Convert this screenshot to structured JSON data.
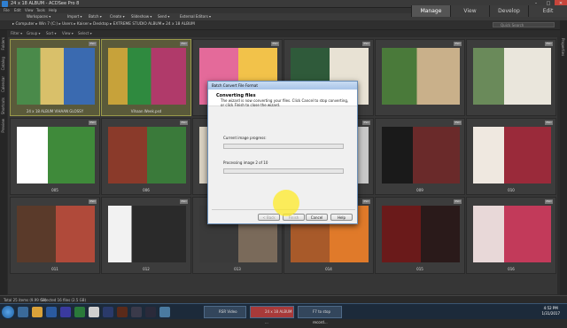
{
  "window": {
    "title": "24 x 18 ALBUM - ACDSee Pro 8"
  },
  "menu": [
    "File",
    "Edit",
    "View",
    "Tools",
    "Help"
  ],
  "toolbar": {
    "items": [
      "Workspaces ▾",
      "Import ▾",
      "Batch ▾",
      "Create ▾",
      "Slideshow ▾",
      "Send ▾",
      "External Editors ▾"
    ],
    "modes": [
      "Manage",
      "View",
      "Develop",
      "Edit"
    ],
    "active_mode": "Manage"
  },
  "path": "▸ Computer ▸ Win 7 (C:) ▸ Users ▸ Kaiser ▸ Desktop ▸ EXTREME STUDIO ALBUM ▸ 24 x 18 ALBUM",
  "quick_search": "Quick Search",
  "filters": [
    "Filter ▾",
    "Group ▾",
    "Sort ▾",
    "View ▾",
    "Select ▾"
  ],
  "left_tabs": [
    "Folders",
    "Catalog",
    "Calendar",
    "Shortcuts",
    "Preview"
  ],
  "right_tabs": [
    "Properties"
  ],
  "thumbnails": [
    {
      "caption": "24 x 18 ALBUM VIHAAN GLOSSY",
      "badge": "PSD",
      "selected": true
    },
    {
      "caption": "Vihaan Week.psd",
      "badge": "PSD",
      "selected": true
    },
    {
      "caption": "",
      "badge": "PSD",
      "selected": false
    },
    {
      "caption": "",
      "badge": "PSD",
      "selected": false
    },
    {
      "caption": "",
      "badge": "PSD",
      "selected": false
    },
    {
      "caption": "",
      "badge": "PSD",
      "selected": false
    },
    {
      "caption": "005",
      "badge": "PSD",
      "selected": false
    },
    {
      "caption": "006",
      "badge": "PSD",
      "selected": false
    },
    {
      "caption": "",
      "badge": "PSD",
      "selected": false
    },
    {
      "caption": "",
      "badge": "PSD",
      "selected": false
    },
    {
      "caption": "009",
      "badge": "PSD",
      "selected": false
    },
    {
      "caption": "010",
      "badge": "PSD",
      "selected": false
    },
    {
      "caption": "011",
      "badge": "PSD",
      "selected": false
    },
    {
      "caption": "012",
      "badge": "PSD",
      "selected": false
    },
    {
      "caption": "013",
      "badge": "PSD",
      "selected": false
    },
    {
      "caption": "014",
      "badge": "PSD",
      "selected": false
    },
    {
      "caption": "015",
      "badge": "PSD",
      "selected": false
    },
    {
      "caption": "016",
      "badge": "PSD",
      "selected": false
    }
  ],
  "dialog": {
    "title": "Batch Convert File Format",
    "heading": "Converting files",
    "subtext": "The wizard is now converting your files. Click Cancel to stop converting, or click Finish to close the wizard.",
    "current_label": "Current image progress:",
    "current_progress": 0.0,
    "processing_label": "Processing image 2 of 10",
    "processing_progress": 0.0,
    "buttons": {
      "back": "< Back",
      "finish": "Finish",
      "cancel": "Cancel",
      "help": "Help"
    }
  },
  "status": {
    "total": "Total 25 items (9.99 GB)",
    "selected": "Selected 16 files (2.5 GB)"
  },
  "taskbar": {
    "apps": [
      "RSR Video",
      "24 x 18 ALBUM ...",
      "F7 to stop record..."
    ],
    "time": "4:52 PM",
    "date": "1/31/2017"
  },
  "colors": {
    "accent": "#9a9a4a",
    "progress": "#36b531",
    "dialog_border": "#6b8fb8"
  }
}
